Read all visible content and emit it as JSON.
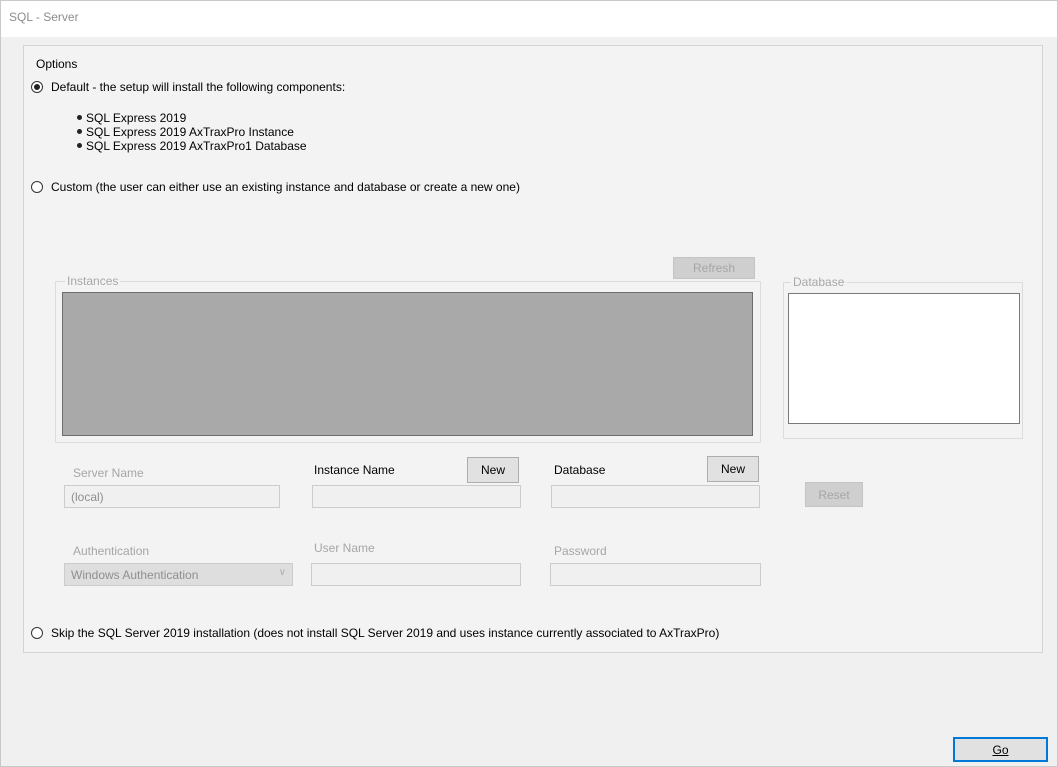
{
  "window": {
    "title": "SQL - Server"
  },
  "options": {
    "group_label": "Options",
    "default": {
      "label": "Default - the setup will install the following components:",
      "selected": true,
      "components": [
        "SQL Express 2019",
        "SQL Express 2019 AxTraxPro Instance",
        "SQL Express 2019 AxTraxPro1 Database"
      ]
    },
    "custom": {
      "label": "Custom (the user can either use an existing instance and database or create a new one)",
      "selected": false,
      "refresh_label": "Refresh",
      "instances_label": "Instances",
      "database_group_label": "Database",
      "server_name_label": "Server Name",
      "server_name_value": "(local)",
      "instance_name_label": "Instance Name",
      "instance_new_label": "New",
      "instance_name_value": "",
      "database_label": "Database",
      "database_new_label": "New",
      "database_value": "",
      "reset_label": "Reset",
      "authentication_label": "Authentication",
      "authentication_value": "Windows Authentication",
      "username_label": "User Name",
      "username_value": "",
      "password_label": "Password",
      "password_value": ""
    },
    "skip": {
      "label": "Skip the SQL Server 2019 installation (does not install SQL Server 2019 and uses instance currently associated to AxTraxPro)",
      "selected": false
    }
  },
  "footer": {
    "go_label": "Go"
  }
}
